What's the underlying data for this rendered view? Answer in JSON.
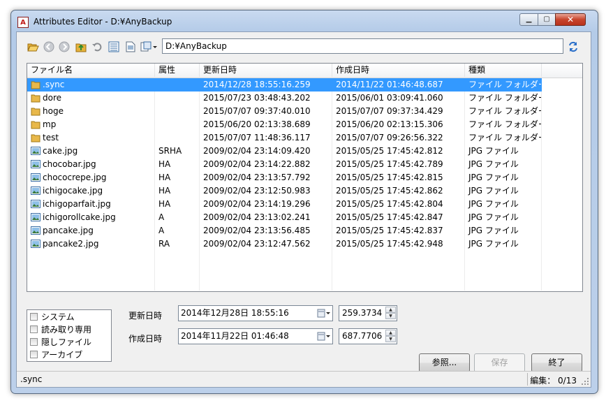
{
  "window": {
    "title": "Attributes Editor - D:¥AnyBackup",
    "app_icon_text": "A"
  },
  "toolbar": {
    "path": "D:¥AnyBackup"
  },
  "columns": [
    "ファイル名",
    "属性",
    "更新日時",
    "作成日時",
    "種類"
  ],
  "rows": [
    {
      "name": ".sync",
      "attr": "",
      "modified": "2014/12/28 18:55:16.259",
      "created": "2014/11/22 01:46:48.687",
      "type": "ファイル フォルダー",
      "icon": "folder-icon",
      "selected": true
    },
    {
      "name": "dore",
      "attr": "",
      "modified": "2015/07/23 03:48:43.202",
      "created": "2015/06/01 03:09:41.060",
      "type": "ファイル フォルダー",
      "icon": "folder-icon"
    },
    {
      "name": "hoge",
      "attr": "",
      "modified": "2015/07/07 09:37:40.010",
      "created": "2015/07/07 09:37:34.429",
      "type": "ファイル フォルダー",
      "icon": "folder-icon"
    },
    {
      "name": "mp",
      "attr": "",
      "modified": "2015/06/20 02:13:38.689",
      "created": "2015/06/20 02:13:15.306",
      "type": "ファイル フォルダー",
      "icon": "folder-icon"
    },
    {
      "name": "test",
      "attr": "",
      "modified": "2015/07/07 11:48:36.117",
      "created": "2015/07/07 09:26:56.322",
      "type": "ファイル フォルダー",
      "icon": "folder-icon"
    },
    {
      "name": "cake.jpg",
      "attr": "SRHA",
      "modified": "2009/02/04 23:14:09.420",
      "created": "2015/05/25 17:45:42.812",
      "type": "JPG ファイル",
      "icon": "image-file-icon"
    },
    {
      "name": "chocobar.jpg",
      "attr": "HA",
      "modified": "2009/02/04 23:14:22.882",
      "created": "2015/05/25 17:45:42.789",
      "type": "JPG ファイル",
      "icon": "image-file-icon"
    },
    {
      "name": "chococrepe.jpg",
      "attr": "HA",
      "modified": "2009/02/04 23:13:57.792",
      "created": "2015/05/25 17:45:42.815",
      "type": "JPG ファイル",
      "icon": "image-file-icon"
    },
    {
      "name": "ichigocake.jpg",
      "attr": "HA",
      "modified": "2009/02/04 23:12:50.983",
      "created": "2015/05/25 17:45:42.862",
      "type": "JPG ファイル",
      "icon": "image-file-icon"
    },
    {
      "name": "ichigoparfait.jpg",
      "attr": "HA",
      "modified": "2009/02/04 23:14:19.296",
      "created": "2015/05/25 17:45:42.804",
      "type": "JPG ファイル",
      "icon": "image-file-icon"
    },
    {
      "name": "ichigorollcake.jpg",
      "attr": "A",
      "modified": "2009/02/04 23:13:02.241",
      "created": "2015/05/25 17:45:42.847",
      "type": "JPG ファイル",
      "icon": "image-file-icon"
    },
    {
      "name": "pancake.jpg",
      "attr": "A",
      "modified": "2009/02/04 23:13:56.485",
      "created": "2015/05/25 17:45:42.837",
      "type": "JPG ファイル",
      "icon": "image-file-icon"
    },
    {
      "name": "pancake2.jpg",
      "attr": "RA",
      "modified": "2009/02/04 23:12:47.562",
      "created": "2015/05/25 17:45:42.948",
      "type": "JPG ファイル",
      "icon": "image-file-icon"
    }
  ],
  "attributes": [
    {
      "label": "システム",
      "checked": false
    },
    {
      "label": "読み取り専用",
      "checked": false
    },
    {
      "label": "隠しファイル",
      "checked": false
    },
    {
      "label": "アーカイブ",
      "checked": false
    }
  ],
  "modified": {
    "label": "更新日時",
    "value": "2014年12月28日 18:55:16",
    "ms": "259.3734"
  },
  "created": {
    "label": "作成日時",
    "value": "2014年11月22日 01:46:48",
    "ms": "687.7706"
  },
  "buttons": {
    "browse": "参照...",
    "save": "保存",
    "close": "終了"
  },
  "status": {
    "left": ".sync",
    "right": "編集： 0/13"
  },
  "colors": {
    "selection": "#3399ff",
    "folder": "#e8b84a"
  }
}
